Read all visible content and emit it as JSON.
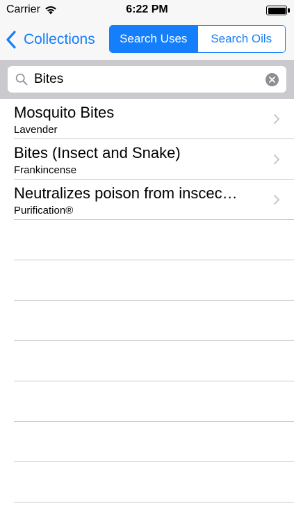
{
  "status_bar": {
    "carrier": "Carrier",
    "time": "6:22 PM",
    "wifi_icon": "wifi-icon",
    "battery_icon": "battery-icon"
  },
  "nav": {
    "back_label": "Collections",
    "segments": [
      {
        "label": "Search Uses",
        "selected": true
      },
      {
        "label": "Search Oils",
        "selected": false
      }
    ]
  },
  "search": {
    "value": "Bites",
    "icon": "search-icon",
    "clear_icon": "clear-icon"
  },
  "results": [
    {
      "title": "Mosquito Bites",
      "subtitle": "Lavender"
    },
    {
      "title": "Bites (Insect and Snake)",
      "subtitle": "Frankincense"
    },
    {
      "title": "Neutralizes poison from inscec…",
      "subtitle": "Purification®"
    }
  ],
  "colors": {
    "accent": "#157efb",
    "bar_bg": "#f7f7f7",
    "search_bar_bg": "#c9c9ce",
    "separator": "#c8c7cc"
  }
}
